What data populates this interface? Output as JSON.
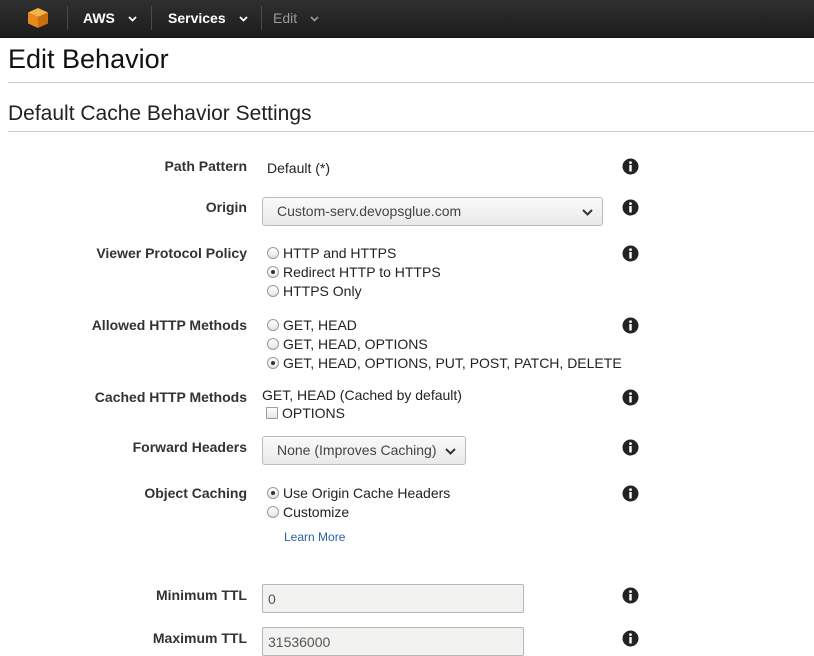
{
  "nav": {
    "brand_label": "AWS",
    "services_label": "Services",
    "edit_label": "Edit"
  },
  "page": {
    "title": "Edit Behavior",
    "section_title": "Default Cache Behavior Settings"
  },
  "form": {
    "path_pattern": {
      "label": "Path Pattern",
      "value": "Default (*)"
    },
    "origin": {
      "label": "Origin",
      "selected": "Custom-serv.devopsglue.com"
    },
    "viewer_protocol_policy": {
      "label": "Viewer Protocol Policy",
      "options": [
        "HTTP and HTTPS",
        "Redirect HTTP to HTTPS",
        "HTTPS Only"
      ],
      "selected": "Redirect HTTP to HTTPS"
    },
    "allowed_http_methods": {
      "label": "Allowed HTTP Methods",
      "options": [
        "GET, HEAD",
        "GET, HEAD, OPTIONS",
        "GET, HEAD, OPTIONS, PUT, POST, PATCH, DELETE"
      ],
      "selected": "GET, HEAD, OPTIONS, PUT, POST, PATCH, DELETE"
    },
    "cached_http_methods": {
      "label": "Cached HTTP Methods",
      "note": "GET, HEAD (Cached by default)",
      "options_label": "OPTIONS",
      "options_checked": false
    },
    "forward_headers": {
      "label": "Forward Headers",
      "selected": "None (Improves Caching)"
    },
    "object_caching": {
      "label": "Object Caching",
      "options": [
        "Use Origin Cache Headers",
        "Customize"
      ],
      "selected": "Use Origin Cache Headers",
      "learn_more": "Learn More"
    },
    "minimum_ttl": {
      "label": "Minimum TTL",
      "value": "0"
    },
    "maximum_ttl": {
      "label": "Maximum TTL",
      "value": "31536000"
    }
  },
  "icons": {
    "logo": "aws-cube-icon",
    "info": "info-icon",
    "dropdown": "chevron-down-icon"
  },
  "colors": {
    "nav_bg": "#232323",
    "logo_orange": "#f39c1f",
    "link": "#2a63a7",
    "input_bg": "#f2f2f0"
  }
}
